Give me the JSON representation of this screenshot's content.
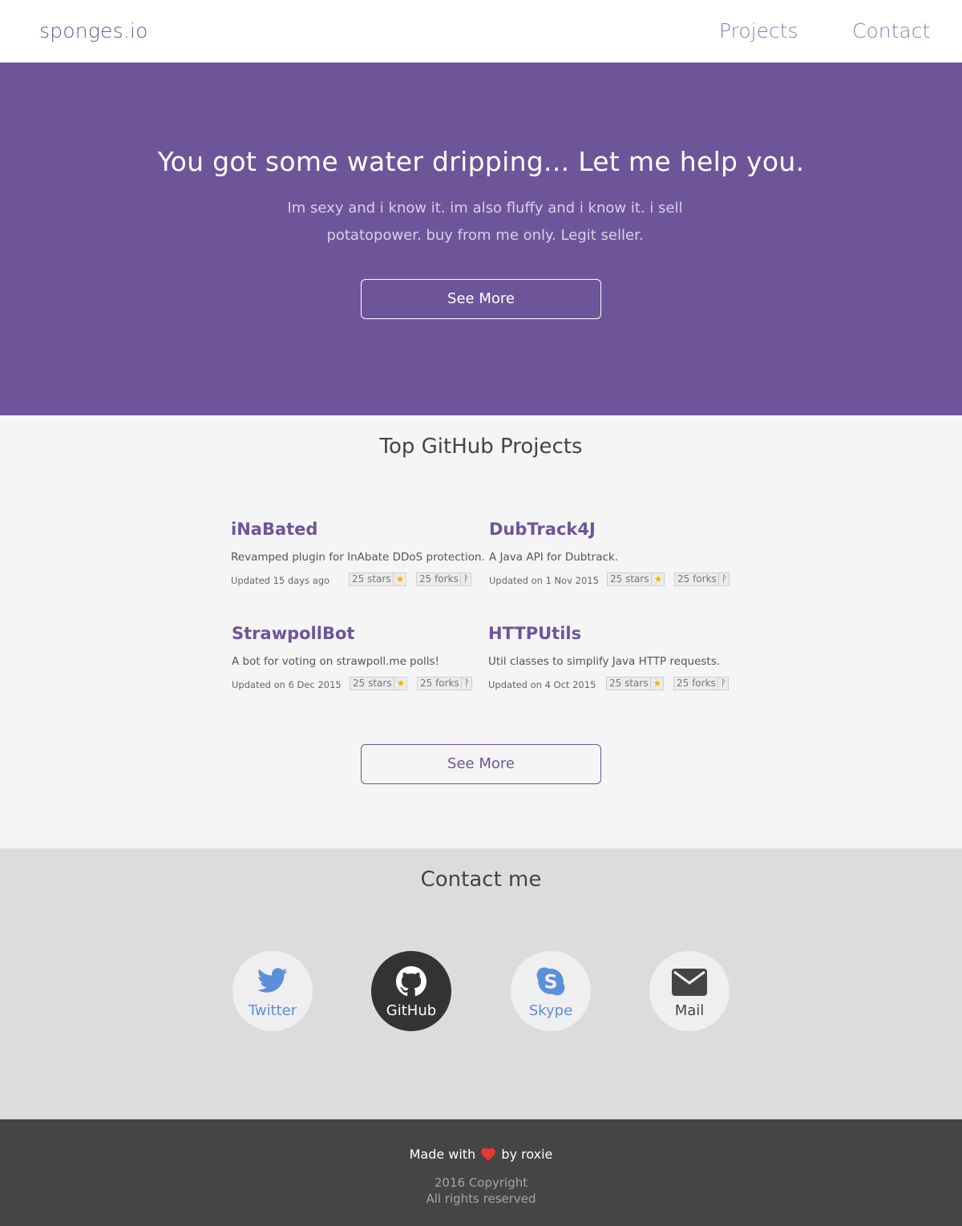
{
  "navbar": {
    "brand": "sponges.io",
    "links": [
      "Projects",
      "Contact"
    ]
  },
  "hero": {
    "title": "You got some water dripping... Let me help you.",
    "text": "Im sexy and i know it. im also fluffy and i know it. i sell potatopower. buy from me only. Legit seller.",
    "button": "See More"
  },
  "projects": {
    "title": "Top GitHub Projects",
    "items": [
      {
        "name": "iNaBated",
        "description": "Revamped plugin for InAbate DDoS protection.",
        "updated": "Updated 15 days ago",
        "stars": "25 stars",
        "forks": "25 forks"
      },
      {
        "name": "DubTrack4J",
        "description": "A Java API for Dubtrack.",
        "updated": "Updated on 1 Nov 2015",
        "stars": "25 stars",
        "forks": "25 forks"
      },
      {
        "name": "StrawpollBot",
        "description": "A bot for voting on strawpoll.me polls!",
        "updated": "Updated on 6 Dec 2015",
        "stars": "25 stars",
        "forks": "25 forks"
      },
      {
        "name": "HTTPUtils",
        "description": "Util classes to simplify Java HTTP requests.",
        "updated": "Updated on 4 Oct 2015",
        "stars": "25 stars",
        "forks": "25 forks"
      }
    ],
    "button": "See More"
  },
  "contact": {
    "title": "Contact me",
    "links": [
      {
        "label": "Twitter",
        "icon": "twitter-icon",
        "color": "#5b8fd9"
      },
      {
        "label": "GitHub",
        "icon": "github-icon",
        "color": "#ffffff"
      },
      {
        "label": "Skype",
        "icon": "skype-icon",
        "color": "#5b8fd9"
      },
      {
        "label": "Mail",
        "icon": "mail-icon",
        "color": "#444444"
      }
    ]
  },
  "footer": {
    "made_prefix": "Made with",
    "made_suffix": "by roxie",
    "copyright": "2016 Copyright",
    "rights": "All rights reserved"
  },
  "colors": {
    "brand_purple": "#6e5599",
    "hero_bg": "#6e5599",
    "projects_bg": "#f5f5f6",
    "contact_bg": "#dcdcdc",
    "footer_bg": "#454545",
    "heart": "#e53935",
    "star": "#f0b400"
  }
}
